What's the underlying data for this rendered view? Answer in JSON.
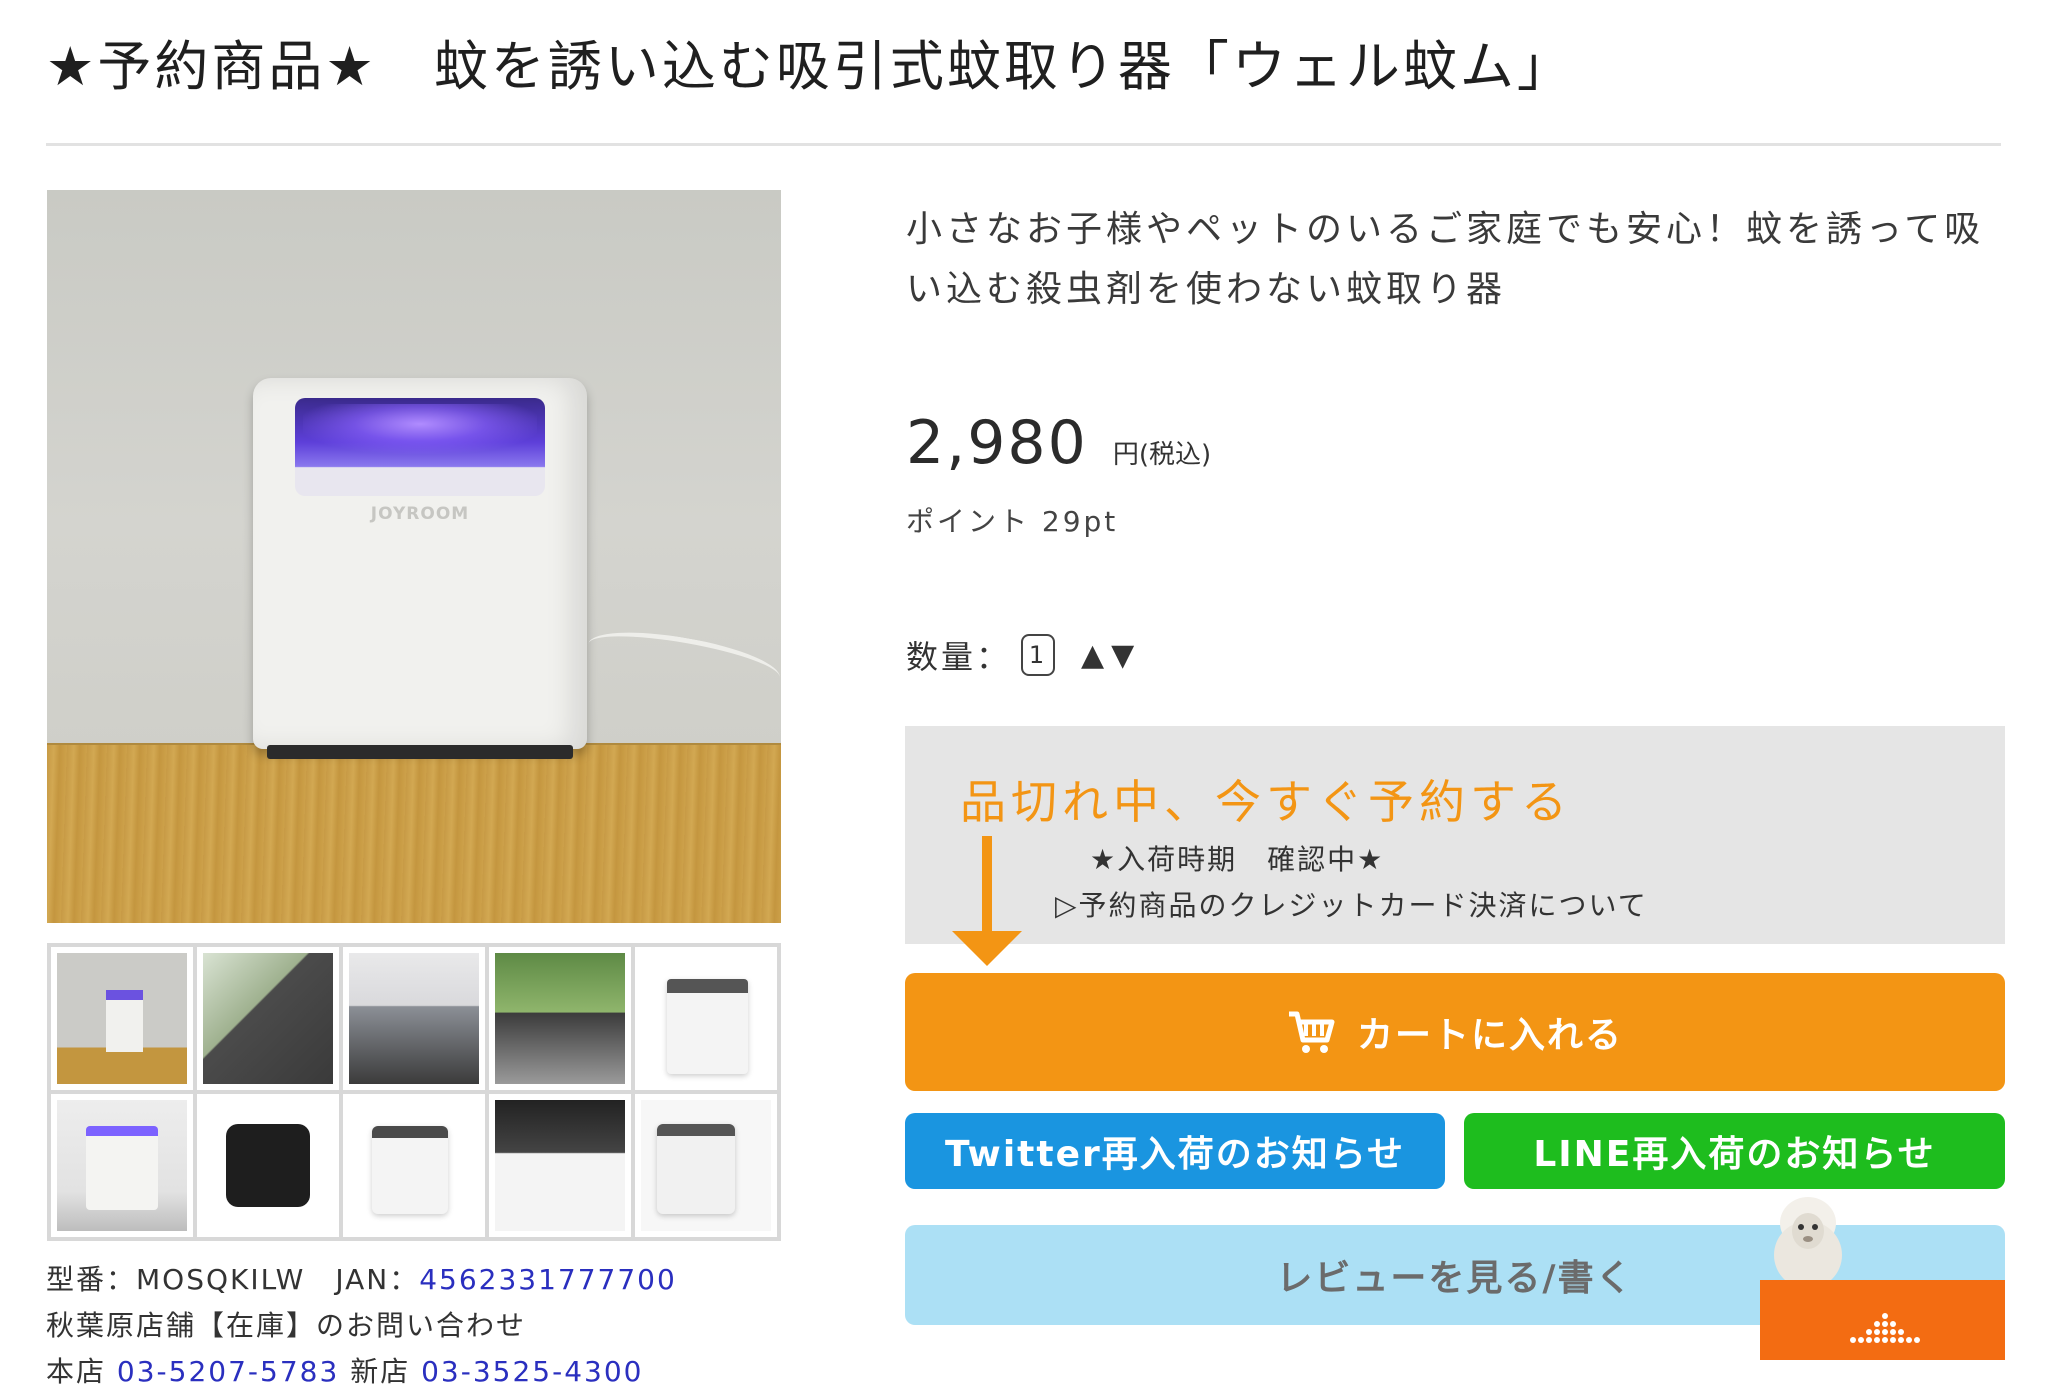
{
  "page": {
    "title": "★予約商品★　蚊を誘い込む吸引式蚊取り器「ウェル蚊ム」"
  },
  "gallery": {
    "main_logo_text": "JOYROOM",
    "thumbnail_count": 10
  },
  "product": {
    "description": "小さなお子様やペットのいるご家庭でも安心！蚊を誘って吸い込む殺虫剤を使わない蚊取り器",
    "price": "2,980",
    "price_unit": "円(税込)",
    "points": "ポイント 29pt",
    "quantity_label": "数量：",
    "quantity_value": "1",
    "quantity_up": "▲",
    "quantity_down": "▼"
  },
  "reserve": {
    "title": "品切れ中、今すぐ予約する",
    "arrival": "★入荷時期　確認中★",
    "credit_link": "▷予約商品のクレジットカード決済について"
  },
  "buttons": {
    "cart": "カートに入れる",
    "twitter": "Twitter再入荷のお知らせ",
    "line": "LINE再入荷のお知らせ",
    "review": "レビューを見る/書く"
  },
  "meta": {
    "model_label": "型番：MOSQKILW　JAN：",
    "jan": "4562331777700",
    "inquiry": "秋葉原店舗【在庫】のお問い合わせ",
    "store_label": "本店",
    "store_phone": "03-5207-5783",
    "new_store_label": "新店",
    "new_store_phone": "03-3525-4300"
  },
  "colors": {
    "accent_orange": "#f39514",
    "twitter_blue": "#1a95e0",
    "line_green": "#1ebd1e",
    "review_lightblue": "#ace0f5",
    "panel_gray": "#e5e5e5",
    "link_blue": "#2a2fbf"
  },
  "icons": {
    "cart": "cart-icon",
    "arrow": "down-arrow-icon",
    "chat": "chat-widget-icon"
  }
}
